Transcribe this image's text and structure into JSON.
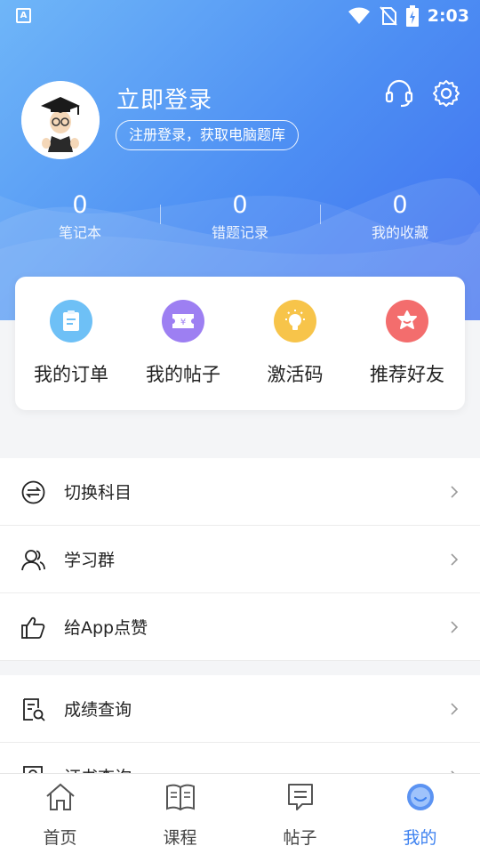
{
  "status_bar": {
    "time": "2:03",
    "app_badge": "A"
  },
  "profile": {
    "login_title": "立即登录",
    "register_hint": "注册登录，获取电脑题库"
  },
  "stats": [
    {
      "value": "0",
      "label": "笔记本"
    },
    {
      "value": "0",
      "label": "错题记录"
    },
    {
      "value": "0",
      "label": "我的收藏"
    }
  ],
  "quick_actions": [
    {
      "label": "我的订单",
      "icon": "clipboard-icon",
      "color": "#63b8f4"
    },
    {
      "label": "我的帖子",
      "icon": "yen-ticket-icon",
      "color": "#9b7cf3"
    },
    {
      "label": "激活码",
      "icon": "lightbulb-icon",
      "color": "#f7c046"
    },
    {
      "label": "推荐好友",
      "icon": "smile-star-icon",
      "color": "#f36a6a"
    }
  ],
  "menu_group_1": [
    {
      "label": "切换科目",
      "icon": "switch-icon"
    },
    {
      "label": "学习群",
      "icon": "group-icon"
    },
    {
      "label": "给App点赞",
      "icon": "thumbs-up-icon"
    }
  ],
  "menu_group_2": [
    {
      "label": "成绩查询",
      "icon": "score-search-icon"
    },
    {
      "label": "证书查询",
      "icon": "certificate-icon"
    }
  ],
  "tabs": [
    {
      "label": "首页",
      "icon": "home-icon"
    },
    {
      "label": "课程",
      "icon": "book-icon"
    },
    {
      "label": "帖子",
      "icon": "post-icon"
    },
    {
      "label": "我的",
      "icon": "profile-smile-icon"
    }
  ],
  "colors": {
    "accent": "#3e82f0",
    "hero_start": "#6fb6f8",
    "hero_end": "#3f6ff0"
  }
}
